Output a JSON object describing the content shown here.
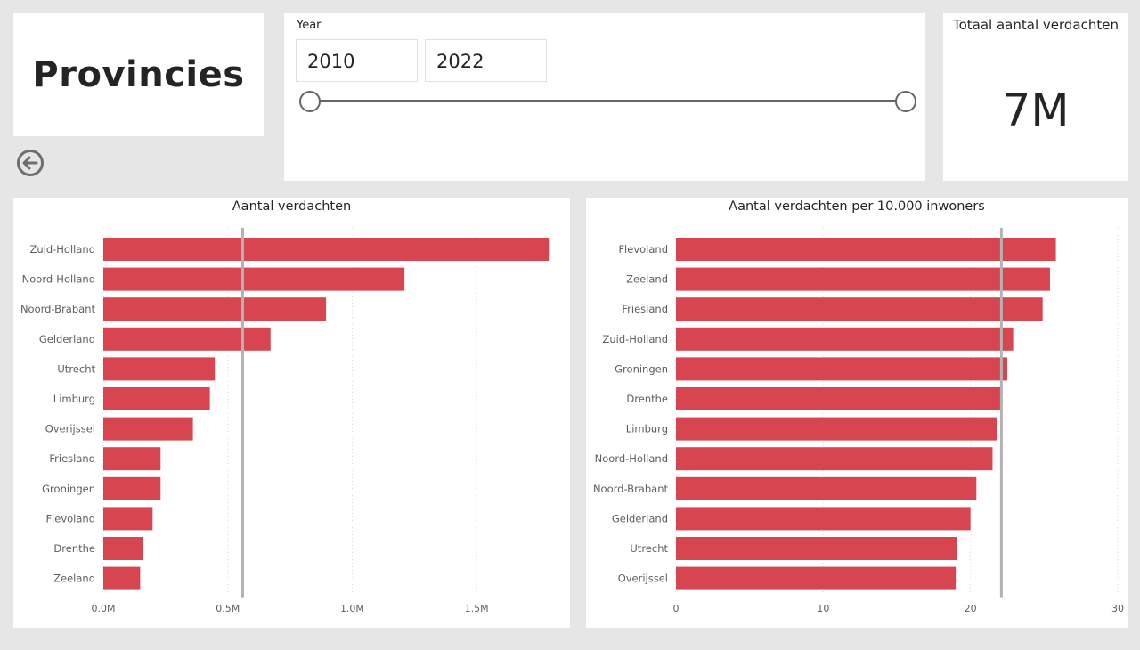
{
  "title_card": {
    "title": "Provincies"
  },
  "slicer": {
    "title": "Year",
    "from": "2010",
    "to": "2022",
    "range": [
      2010,
      2022
    ]
  },
  "kpi": {
    "title": "Totaal aantal verdachten",
    "value": "7M"
  },
  "colors": {
    "bar": "#d64550",
    "reference_line": "#b3b3b3",
    "grid": "#d9d9d9",
    "background": "#e6e6e6"
  },
  "icons": {
    "back": "arrow-left-circle-icon"
  },
  "chart_data": [
    {
      "type": "bar",
      "orientation": "horizontal",
      "title": "Aantal verdachten",
      "categories": [
        "Zuid-Holland",
        "Noord-Holland",
        "Noord-Brabant",
        "Gelderland",
        "Utrecht",
        "Limburg",
        "Overijssel",
        "Friesland",
        "Groningen",
        "Flevoland",
        "Drenthe",
        "Zeeland"
      ],
      "values": [
        1790000,
        1210000,
        895000,
        672000,
        448000,
        428000,
        360000,
        230000,
        230000,
        198000,
        160000,
        148000
      ],
      "average_line": 560000,
      "xlim": [
        0,
        1800000
      ],
      "ticks": [
        0,
        500000,
        1000000,
        1500000
      ],
      "tick_labels": [
        "0.0M",
        "0.5M",
        "1.0M",
        "1.5M"
      ],
      "grid": true
    },
    {
      "type": "bar",
      "orientation": "horizontal",
      "title": "Aantal verdachten per 10.000 inwoners",
      "categories": [
        "Flevoland",
        "Zeeland",
        "Friesland",
        "Zuid-Holland",
        "Groningen",
        "Drenthe",
        "Limburg",
        "Noord-Holland",
        "Noord-Brabant",
        "Gelderland",
        "Utrecht",
        "Overijssel"
      ],
      "values": [
        25.8,
        25.4,
        24.9,
        22.9,
        22.5,
        22.1,
        21.8,
        21.5,
        20.4,
        20.0,
        19.1,
        19.0
      ],
      "average_line": 22.1,
      "xlim": [
        0,
        30
      ],
      "ticks": [
        0,
        10,
        20,
        30
      ],
      "tick_labels": [
        "0",
        "10",
        "20",
        "30"
      ],
      "grid": true
    }
  ]
}
